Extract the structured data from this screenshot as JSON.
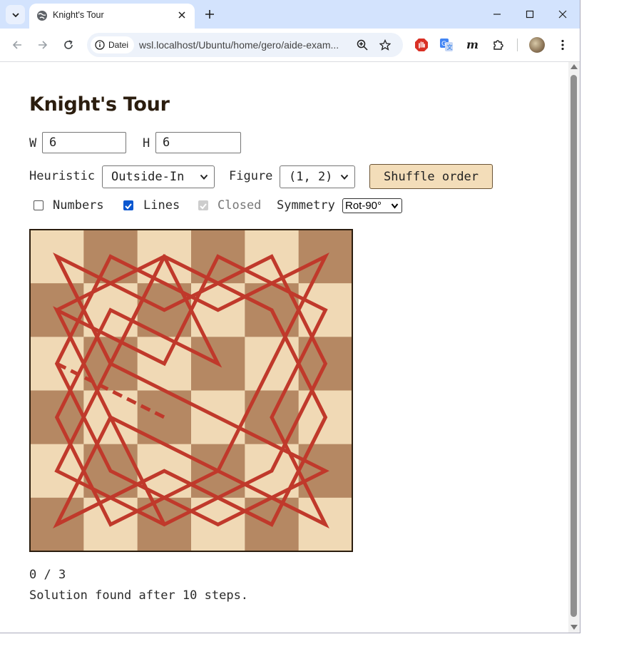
{
  "browser": {
    "tab_title": "Knight's Tour",
    "security_chip": "Datei",
    "url": "wsl.localhost/Ubuntu/home/gero/aide-exam..."
  },
  "page": {
    "title": "Knight's Tour",
    "width_label": "W",
    "width_value": "6",
    "height_label": "H",
    "height_value": "6",
    "heuristic_label": "Heuristic",
    "heuristic_value": "Outside-In",
    "figure_label": "Figure",
    "figure_value": "(1, 2)",
    "shuffle_label": "Shuffle order",
    "numbers_label": "Numbers",
    "numbers_checked": false,
    "lines_label": "Lines",
    "lines_checked": true,
    "closed_label": "Closed",
    "closed_checked": true,
    "closed_disabled": true,
    "symmetry_label": "Symmetry",
    "symmetry_value": "Rot-90°",
    "counter": "0 / 3",
    "status": "Solution found after 10 steps."
  },
  "board": {
    "cols": 6,
    "rows": 6,
    "light_color": "#f0d9b5",
    "dark_color": "#b58863",
    "line_color": "#c0392b",
    "tour_path": [
      [
        0,
        0
      ],
      [
        1,
        2
      ],
      [
        2,
        0
      ],
      [
        4,
        1
      ],
      [
        5,
        3
      ],
      [
        4,
        5
      ],
      [
        2,
        4
      ],
      [
        0,
        5
      ],
      [
        1,
        3
      ],
      [
        0,
        1
      ],
      [
        2,
        2
      ],
      [
        3,
        0
      ],
      [
        5,
        1
      ],
      [
        4,
        3
      ],
      [
        5,
        5
      ],
      [
        3,
        4
      ],
      [
        1,
        5
      ],
      [
        0,
        3
      ],
      [
        1,
        1
      ],
      [
        3,
        2
      ],
      [
        2,
        0
      ],
      [
        0,
        1
      ]
    ],
    "tour_path_b": [
      [
        0,
        5
      ],
      [
        2,
        4
      ],
      [
        4,
        5
      ],
      [
        5,
        3
      ],
      [
        4,
        1
      ],
      [
        2,
        0
      ],
      [
        1,
        2
      ],
      [
        0,
        0
      ],
      [
        2,
        1
      ],
      [
        4,
        0
      ],
      [
        5,
        2
      ],
      [
        4,
        4
      ],
      [
        2,
        5
      ],
      [
        0,
        4
      ],
      [
        1,
        2
      ],
      [
        3,
        3
      ],
      [
        5,
        4
      ],
      [
        3,
        5
      ],
      [
        1,
        4
      ],
      [
        0,
        2
      ],
      [
        1,
        0
      ],
      [
        3,
        1
      ],
      [
        5,
        0
      ],
      [
        4,
        2
      ],
      [
        3,
        4
      ],
      [
        1,
        3
      ],
      [
        2,
        5
      ]
    ],
    "open_segment": [
      [
        0,
        2
      ],
      [
        2,
        3
      ]
    ]
  }
}
